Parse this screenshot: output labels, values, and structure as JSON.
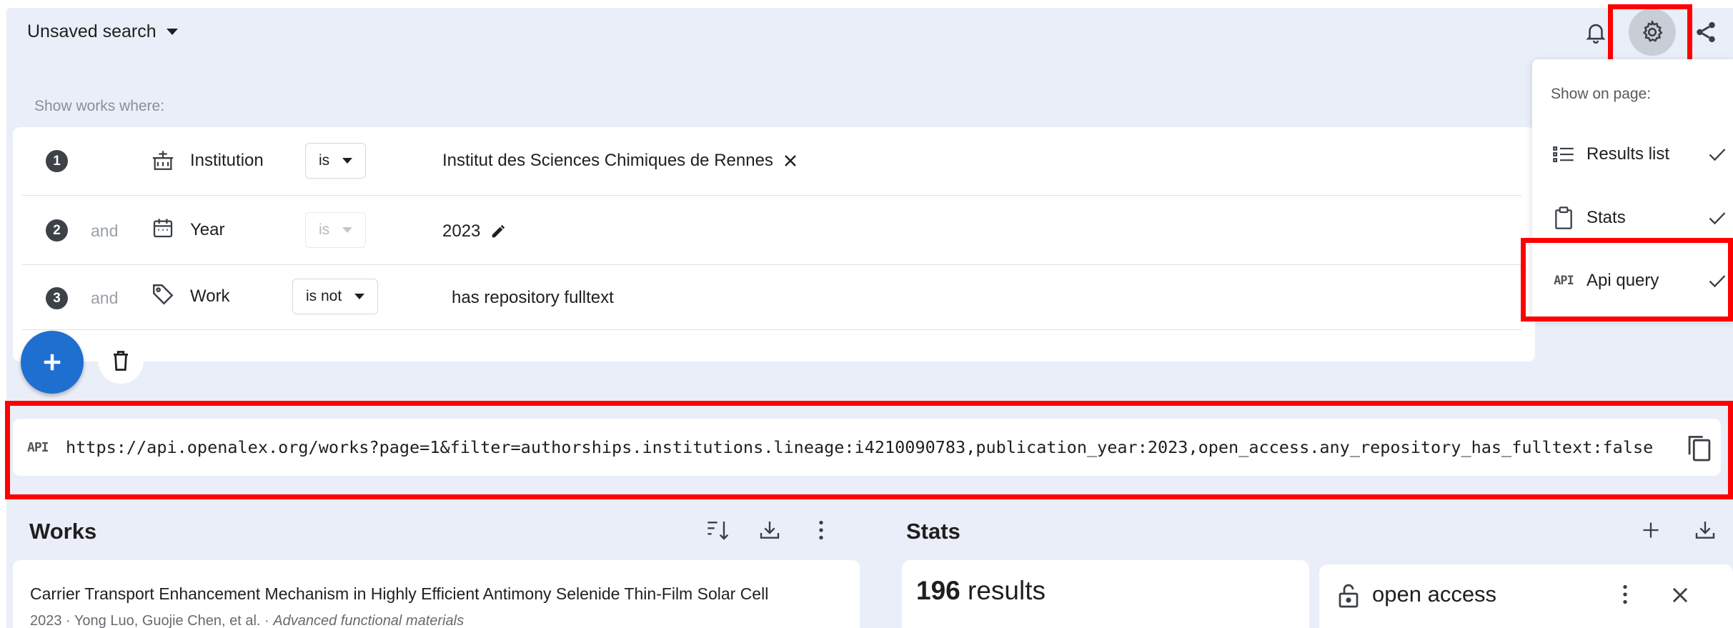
{
  "header": {
    "search_title": "Unsaved search"
  },
  "filters": {
    "heading": "Show works where:",
    "rows": [
      {
        "number": "1",
        "conjunction": "",
        "icon": "institution-icon",
        "field": "Institution",
        "operator": "is",
        "value": "Institut des Sciences Chimiques de Rennes"
      },
      {
        "number": "2",
        "conjunction": "and",
        "icon": "calendar-icon",
        "field": "Year",
        "operator": "is",
        "value": "2023"
      },
      {
        "number": "3",
        "conjunction": "and",
        "icon": "tag-icon",
        "field": "Work",
        "operator": "is not",
        "value": "has repository fulltext"
      }
    ]
  },
  "settings_menu": {
    "heading": "Show on page:",
    "items": [
      {
        "label": "Results list",
        "icon": "list-icon",
        "checked": true
      },
      {
        "label": "Stats",
        "icon": "clipboard-icon",
        "checked": true
      },
      {
        "label": "Api query",
        "icon": "api-icon",
        "icon_text": "API",
        "checked": true
      }
    ]
  },
  "api_bar": {
    "tag": "API",
    "url": "https://api.openalex.org/works?page=1&filter=authorships.institutions.lineage:i4210090783,publication_year:2023,open_access.any_repository_has_fulltext:false"
  },
  "works": {
    "title": "Works",
    "first_result": {
      "title": "Carrier Transport Enhancement Mechanism in Highly Efficient Antimony Selenide Thin-Film Solar Cell",
      "meta_prefix": "2023 · Yong Luo, Guojie Chen, et al. · ",
      "journal": "Advanced functional materials"
    }
  },
  "stats": {
    "title": "Stats",
    "result_count": "196",
    "result_label": " results",
    "card_label": "open access"
  },
  "colors": {
    "page_background": "#e9eef8",
    "fab": "#1f6fd1",
    "highlight": "#ff0000"
  }
}
